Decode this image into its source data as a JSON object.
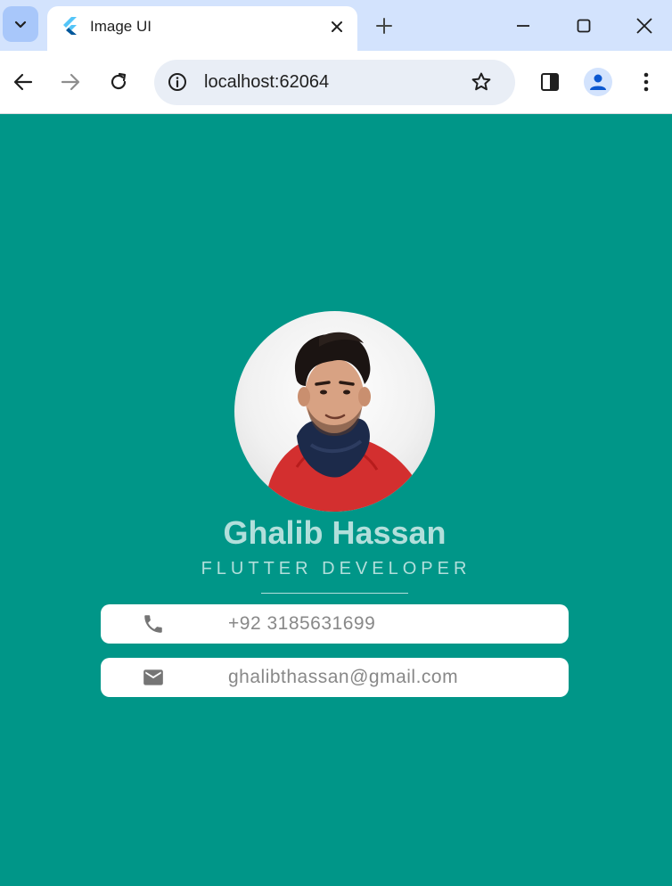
{
  "browser": {
    "tab_title": "Image UI",
    "url": "localhost:62064"
  },
  "profile": {
    "name": "Ghalib Hassan",
    "title": "FLUTTER DEVELOPER"
  },
  "contacts": [
    {
      "icon": "phone-icon",
      "text": "+92 3185631699"
    },
    {
      "icon": "mail-icon",
      "text": "ghalibthassan@gmail.com"
    }
  ],
  "colors": {
    "background": "#009688",
    "accent_text": "#b2dfdb",
    "card": "#ffffff",
    "card_text": "#888888",
    "icon": "#757575"
  }
}
